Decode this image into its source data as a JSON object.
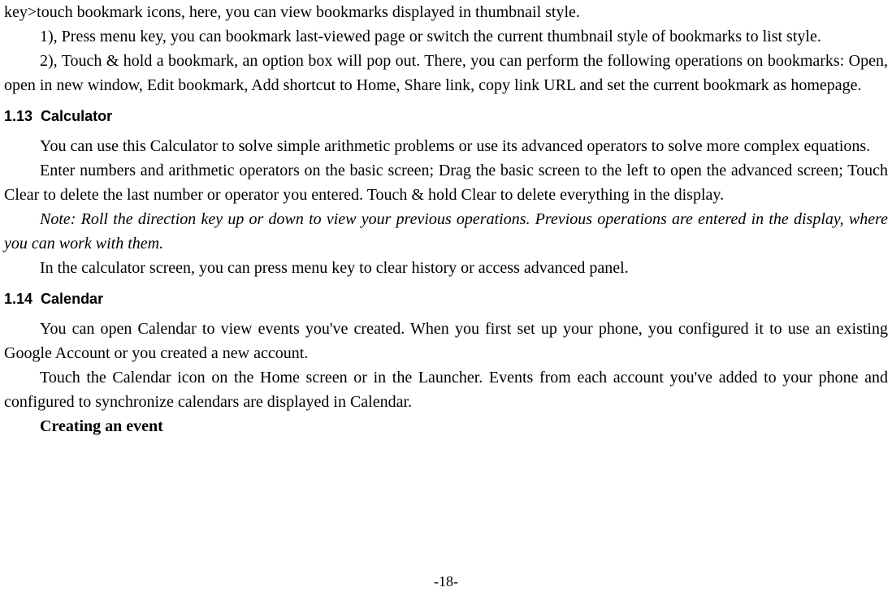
{
  "topFragment": {
    "line1": "key>touch bookmark icons, here, you can view bookmarks displayed in thumbnail style.",
    "item1": "1), Press menu key, you can bookmark last-viewed page or switch the current thumbnail style of bookmarks to list style.",
    "item2": "2), Touch & hold a bookmark, an option box will pop out. There, you can perform the following operations on bookmarks: Open, open in new window, Edit bookmark, Add shortcut to Home, Share link, copy link URL and set the current bookmark as homepage."
  },
  "section113": {
    "num": "1.13",
    "title": "Calculator",
    "p1": "You can use this Calculator to solve simple arithmetic problems or use its advanced operators to solve more complex equations.",
    "p2": "Enter numbers and arithmetic operators on the basic screen; Drag the basic screen to the left to open the advanced screen; Touch Clear to delete the last number or operator you entered. Touch & hold Clear to delete everything in the display.",
    "note": "Note: Roll the direction key up or down to view your previous operations. Previous operations are entered in the display, where you can work with them.",
    "p3": "In the calculator screen, you can press menu key to clear history or access advanced panel."
  },
  "section114": {
    "num": "1.14",
    "title": "Calendar",
    "p1": "You can open Calendar to view events you've created. When you first set up your phone, you configured it to use an existing Google Account or you created a new account.",
    "p2": "Touch the Calendar icon on the Home screen or in the Launcher. Events from each account you've added to your phone and configured to synchronize calendars are displayed in Calendar.",
    "subheading": "Creating an event"
  },
  "pageNumber": "-18-"
}
